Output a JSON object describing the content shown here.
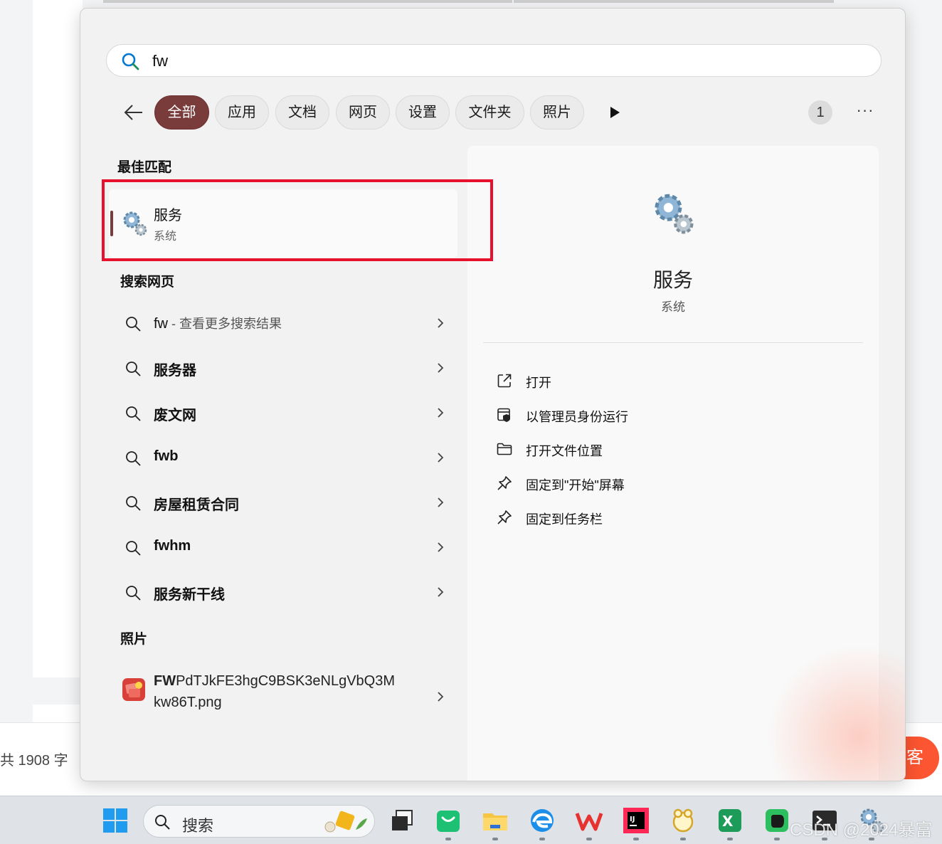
{
  "search": {
    "query": "fw"
  },
  "filters": {
    "chips": [
      "全部",
      "应用",
      "文档",
      "网页",
      "设置",
      "文件夹",
      "照片"
    ],
    "count_badge": "1",
    "more_label": "···"
  },
  "best_match": {
    "title": "最佳匹配",
    "name": "服务",
    "subtitle": "系统"
  },
  "web_search": {
    "title": "搜索网页",
    "first": {
      "query": "fw",
      "suffix": " - 查看更多搜索结果"
    },
    "items": [
      "服务器",
      "废文网",
      "fwb",
      "房屋租赁合同",
      "fwhm",
      "服务新干线"
    ]
  },
  "photos": {
    "title": "照片",
    "file_bold": "FW",
    "file_rest": "PdTJkFE3hgC9BSK3eNLgVbQ3Mkw86T.png"
  },
  "detail": {
    "name": "服务",
    "subtitle": "系统",
    "actions": [
      {
        "label": "打开",
        "icon": "open-external-icon"
      },
      {
        "label": "以管理员身份运行",
        "icon": "run-as-admin-icon"
      },
      {
        "label": "打开文件位置",
        "icon": "folder-icon"
      },
      {
        "label": "固定到\"开始\"屏幕",
        "icon": "pin-icon"
      },
      {
        "label": "固定到任务栏",
        "icon": "pin-icon"
      }
    ]
  },
  "background": {
    "word_count": "共 1908 字",
    "orange_button": "客"
  },
  "taskbar": {
    "search_label": "搜索",
    "watermark": "CSDN @2024暴富"
  },
  "colors": {
    "accent": "#7a3b3b",
    "highlight_box": "#e8112d",
    "search_icon": "#0078d4"
  }
}
